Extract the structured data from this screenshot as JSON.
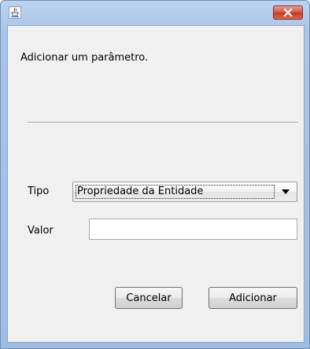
{
  "dialog": {
    "message": "Adicionar um parâmetro.",
    "tipo_label": "Tipo",
    "tipo_value": "Propriedade da Entidade",
    "valor_label": "Valor",
    "valor_value": "",
    "cancel_label": "Cancelar",
    "add_label": "Adicionar"
  },
  "icons": {
    "app": "java-coffee-icon",
    "close": "close-icon",
    "dropdown": "chevron-down-icon"
  },
  "colors": {
    "frame": "#a9c4e6",
    "close_button": "#c9412c",
    "client_bg": "#f0f0f0"
  }
}
